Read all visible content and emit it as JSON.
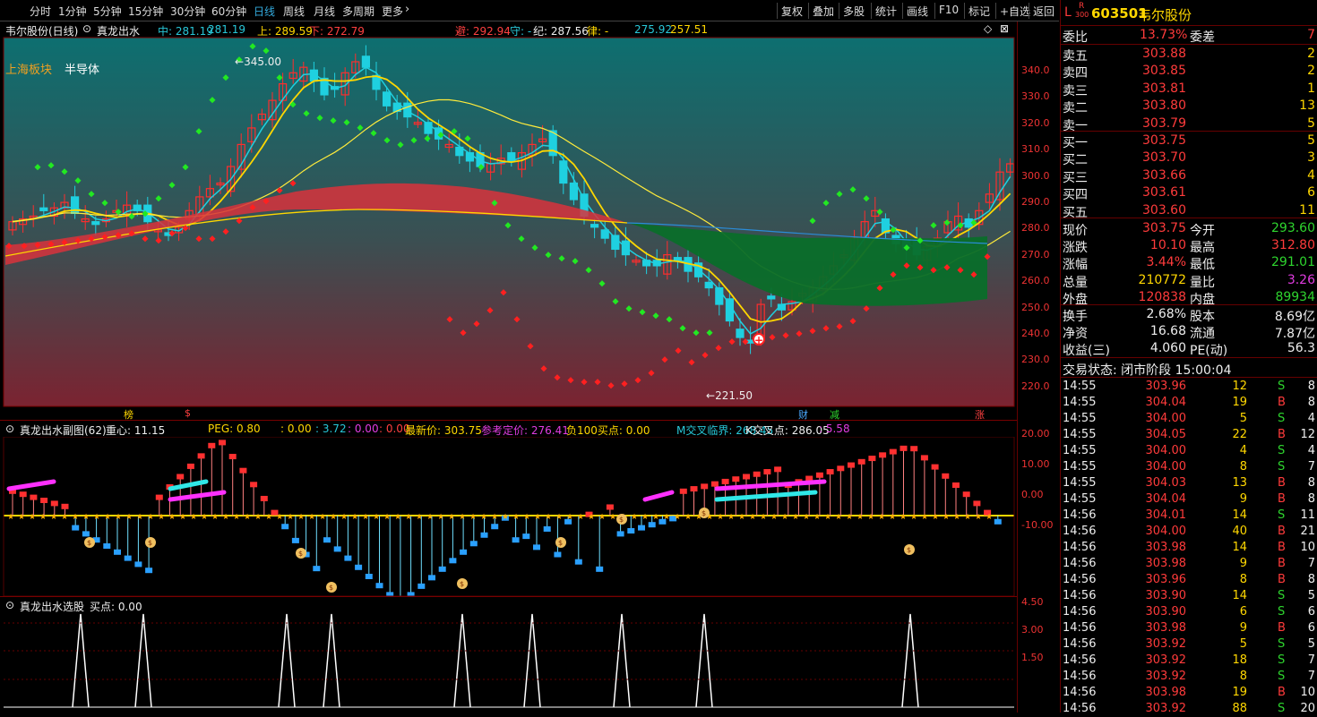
{
  "toolbar": {
    "periods": [
      "分时",
      "1分钟",
      "5分钟",
      "15分钟",
      "30分钟",
      "60分钟",
      "日线",
      "周线",
      "月线",
      "多周期",
      "更多"
    ],
    "active_period": "日线",
    "buttons": [
      "复权",
      "叠加",
      "多股",
      "统计",
      "画线",
      "F10",
      "标记",
      "+自选",
      "返回"
    ]
  },
  "main_chart": {
    "stock_title": "韦尔股份(日线)",
    "indicator_name": "真龙出水",
    "legend": [
      {
        "label": "中: 281.19",
        "color": "#28c7d8"
      },
      {
        "label": "281.19",
        "color": "#28c7d8"
      },
      {
        "label": "上: 289.59",
        "color": "#ffd700"
      },
      {
        "label": "下: 272.79",
        "color": "#ff4040"
      },
      {
        "label": "避: 292.94",
        "color": "#ff4040"
      },
      {
        "label": "守: -",
        "color": "#28c7d8"
      },
      {
        "label": "纪: 287.56",
        "color": "#eee"
      },
      {
        "label": "律: -",
        "color": "#ffd700"
      },
      {
        "label": "275.92",
        "color": "#28c7d8"
      },
      {
        "label": "257.51",
        "color": "#ffd700"
      }
    ],
    "sector_label": "上海板块",
    "industry_label": "半导体",
    "high_marker": "345.00",
    "low_marker": "221.50",
    "y_ticks": [
      "340.0",
      "330.0",
      "320.0",
      "310.0",
      "300.0",
      "290.0",
      "280.0",
      "270.0",
      "260.0",
      "250.0",
      "240.0",
      "230.0",
      "220.0"
    ],
    "event_tags": [
      {
        "text": "榜",
        "color": "#ffd700"
      },
      {
        "text": "$",
        "color": "#ff4040"
      },
      {
        "text": "财",
        "color": "#4aa8ff"
      },
      {
        "text": "减",
        "color": "#2ed52e"
      },
      {
        "text": "涨",
        "color": "#ff4040"
      }
    ]
  },
  "sub1": {
    "title": "真龙出水副图(62)",
    "legend": [
      {
        "label": "重心: 11.15",
        "color": "#eee"
      },
      {
        "label": "PEG: 0.80",
        "color": "#ffd700"
      },
      {
        "label": ": 0.00",
        "color": "#ffd700"
      },
      {
        "label": ": 3.72",
        "color": "#28c7d8"
      },
      {
        "label": ": 0.00",
        "color": "#e03ce0"
      },
      {
        "label": ": 0.00",
        "color": "#ff4040"
      },
      {
        "label": "最新价: 303.75",
        "color": "#ffd700"
      },
      {
        "label": "参考定价: 276.41",
        "color": "#e03ce0"
      },
      {
        "label": "负100买点: 0.00",
        "color": "#ffd700"
      },
      {
        "label": "M交叉临界: 268.45",
        "color": "#28c7d8"
      },
      {
        "label": "K交叉点: 286.05",
        "color": "#eee"
      },
      {
        "label": ": 5.58",
        "color": "#e03ce0"
      }
    ],
    "y_ticks": [
      "20.00",
      "10.00",
      "0.00",
      "-10.00"
    ]
  },
  "sub2": {
    "title": "真龙出水选股",
    "legend": "买点: 0.00",
    "y_ticks": [
      "4.50",
      "3.00",
      "1.50"
    ]
  },
  "quote": {
    "code": "603501",
    "name": "韦尔股份",
    "prefix": "L",
    "tag_top": "R",
    "tag_bottom": "300",
    "weibi_label": "委比",
    "weibi": "13.73%",
    "weicha_label": "委差",
    "weicha": "7",
    "sells": [
      {
        "label": "卖五",
        "price": "303.88",
        "vol": "2"
      },
      {
        "label": "卖四",
        "price": "303.85",
        "vol": "2"
      },
      {
        "label": "卖三",
        "price": "303.81",
        "vol": "1"
      },
      {
        "label": "卖二",
        "price": "303.80",
        "vol": "13"
      },
      {
        "label": "卖一",
        "price": "303.79",
        "vol": "5"
      }
    ],
    "buys": [
      {
        "label": "买一",
        "price": "303.75",
        "vol": "5"
      },
      {
        "label": "买二",
        "price": "303.70",
        "vol": "3"
      },
      {
        "label": "买三",
        "price": "303.66",
        "vol": "4"
      },
      {
        "label": "买四",
        "price": "303.61",
        "vol": "6"
      },
      {
        "label": "买五",
        "price": "303.60",
        "vol": "11"
      }
    ],
    "stats": [
      {
        "l1": "现价",
        "v1": "303.75",
        "c1": "red",
        "l2": "今开",
        "v2": "293.60",
        "c2": "green"
      },
      {
        "l1": "涨跌",
        "v1": "10.10",
        "c1": "red",
        "l2": "最高",
        "v2": "312.80",
        "c2": "red"
      },
      {
        "l1": "涨幅",
        "v1": "3.44%",
        "c1": "red",
        "l2": "最低",
        "v2": "291.01",
        "c2": "green"
      },
      {
        "l1": "总量",
        "v1": "210772",
        "c1": "yellow",
        "l2": "量比",
        "v2": "3.26",
        "c2": "magenta"
      },
      {
        "l1": "外盘",
        "v1": "120838",
        "c1": "red",
        "l2": "内盘",
        "v2": "89934",
        "c2": "green"
      }
    ],
    "fundamentals": [
      {
        "l1": "换手",
        "v1": "2.68%",
        "l2": "股本",
        "v2": "8.69亿"
      },
      {
        "l1": "净资",
        "v1": "16.68",
        "l2": "流通",
        "v2": "7.87亿"
      },
      {
        "l1": "收益(三)",
        "v1": "4.060",
        "l2": "PE(动)",
        "v2": "56.3"
      }
    ],
    "trade_status": "交易状态: 闭市阶段 15:00:04"
  },
  "ticks": [
    {
      "t": "14:55",
      "p": "303.96",
      "v": "12",
      "s": "S",
      "n": "8"
    },
    {
      "t": "14:55",
      "p": "304.04",
      "v": "19",
      "s": "B",
      "n": "8"
    },
    {
      "t": "14:55",
      "p": "304.00",
      "v": "5",
      "s": "S",
      "n": "4"
    },
    {
      "t": "14:55",
      "p": "304.05",
      "v": "22",
      "s": "B",
      "n": "12"
    },
    {
      "t": "14:55",
      "p": "304.00",
      "v": "4",
      "s": "S",
      "n": "4"
    },
    {
      "t": "14:55",
      "p": "304.00",
      "v": "8",
      "s": "S",
      "n": "7"
    },
    {
      "t": "14:55",
      "p": "304.03",
      "v": "13",
      "s": "B",
      "n": "8"
    },
    {
      "t": "14:55",
      "p": "304.04",
      "v": "9",
      "s": "B",
      "n": "8"
    },
    {
      "t": "14:56",
      "p": "304.01",
      "v": "14",
      "s": "S",
      "n": "11"
    },
    {
      "t": "14:56",
      "p": "304.00",
      "v": "40",
      "s": "B",
      "n": "21"
    },
    {
      "t": "14:56",
      "p": "303.98",
      "v": "14",
      "s": "B",
      "n": "10"
    },
    {
      "t": "14:56",
      "p": "303.98",
      "v": "9",
      "s": "B",
      "n": "7"
    },
    {
      "t": "14:56",
      "p": "303.96",
      "v": "8",
      "s": "B",
      "n": "8"
    },
    {
      "t": "14:56",
      "p": "303.90",
      "v": "14",
      "s": "S",
      "n": "5"
    },
    {
      "t": "14:56",
      "p": "303.90",
      "v": "6",
      "s": "S",
      "n": "6"
    },
    {
      "t": "14:56",
      "p": "303.98",
      "v": "9",
      "s": "B",
      "n": "6"
    },
    {
      "t": "14:56",
      "p": "303.92",
      "v": "5",
      "s": "S",
      "n": "5"
    },
    {
      "t": "14:56",
      "p": "303.92",
      "v": "18",
      "s": "S",
      "n": "7"
    },
    {
      "t": "14:56",
      "p": "303.92",
      "v": "8",
      "s": "S",
      "n": "7"
    },
    {
      "t": "14:56",
      "p": "303.98",
      "v": "19",
      "s": "B",
      "n": "10"
    },
    {
      "t": "14:56",
      "p": "303.92",
      "v": "88",
      "s": "S",
      "n": "20"
    }
  ],
  "colors": {
    "up": "#ff3b3b",
    "down": "#28c7d8",
    "ma_yellow": "#ffd700",
    "dots_green": "#22dd22",
    "dots_red": "#ff2020",
    "bg_top": "#0e6e6e",
    "bg_bottom": "#7a2330"
  }
}
